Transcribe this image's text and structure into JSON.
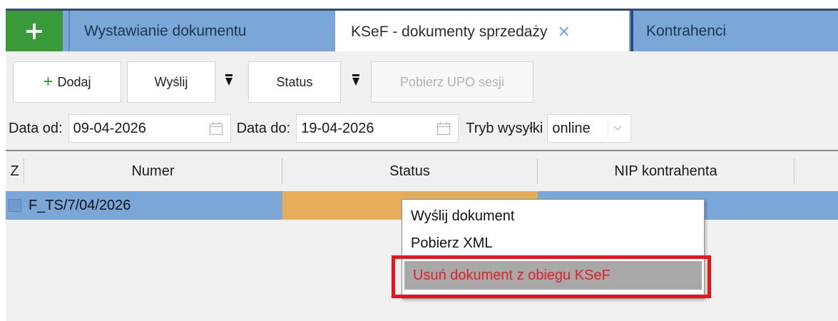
{
  "tabs": {
    "add_icon": "plus-icon",
    "items": [
      {
        "label": "Wystawianie dokumentu"
      },
      {
        "label": "KSeF - dokumenty sprzedaży",
        "close": "✕"
      },
      {
        "label": "Kontrahenci"
      }
    ]
  },
  "toolbar": {
    "add_plus": "+",
    "add_label": "Dodaj",
    "send_label": "Wyślij",
    "status_label": "Status",
    "upo_label": "Pobierz UPO sesji"
  },
  "filters": {
    "date_from_label": "Data od:",
    "date_from_value": "09-04-2026",
    "date_to_label": "Data do:",
    "date_to_value": "19-04-2026",
    "mode_label": "Tryb wysyłki",
    "mode_value": "online"
  },
  "grid": {
    "columns": [
      "Z",
      "Numer",
      "Status",
      "NIP kontrahenta"
    ],
    "rows": [
      {
        "numer": "F_TS/7/04/2026",
        "status": "",
        "nip": ""
      }
    ]
  },
  "context_menu": {
    "items": [
      {
        "label": "Wyślij dokument"
      },
      {
        "label": "Pobierz XML"
      },
      {
        "label": "Usuń dokument z obiegu KSeF"
      }
    ]
  },
  "colors": {
    "tab_blue": "#7ba7d8",
    "add_green": "#3a9a3a",
    "row_selected": "#7ba7d8",
    "status_orange": "#e6ae5c",
    "highlight_red": "#e8141e"
  }
}
